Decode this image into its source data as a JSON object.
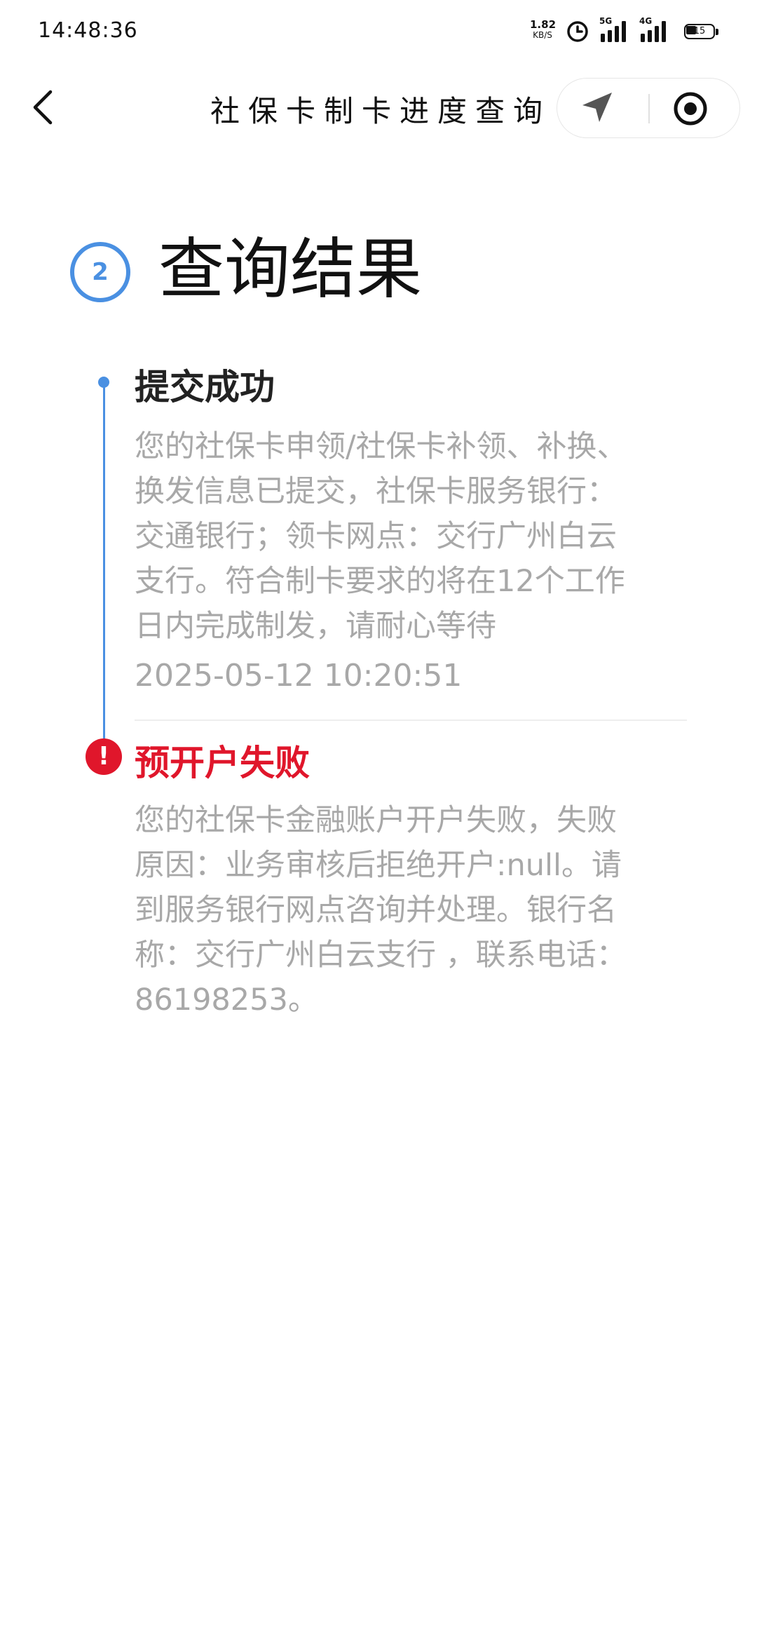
{
  "status_bar": {
    "time": "14:48:36",
    "net_speed_value": "1.82",
    "net_speed_unit": "KB/S",
    "net_5g": "5G",
    "net_4g": "4G",
    "battery": "15"
  },
  "nav": {
    "title": "社保卡制卡进度查询"
  },
  "step": {
    "number": "2",
    "title": "查询结果"
  },
  "entries": [
    {
      "title": "提交成功",
      "status": "success",
      "lines": [
        "您的社保卡申领/社保卡补领、补换、",
        "换发信息已提交，社保卡服务银行：",
        "交通银行；领卡网点：交行广州白云",
        "支行。符合制卡要求的将在12个工作",
        "日内完成制发，请耐心等待"
      ],
      "time": "2025-05-12 10:20:51"
    },
    {
      "title": "预开户失败",
      "status": "error",
      "lines": [
        "您的社保卡金融账户开户失败，失败",
        "原因：业务审核后拒绝开户:null。请",
        "到服务银行网点咨询并处理。银行名",
        "称：交行广州白云支行 ，联系电话：",
        "86198253。"
      ]
    }
  ],
  "colors": {
    "accent": "#4a90e2",
    "error": "#e0162b",
    "muted_text": "#a8a8a8"
  }
}
